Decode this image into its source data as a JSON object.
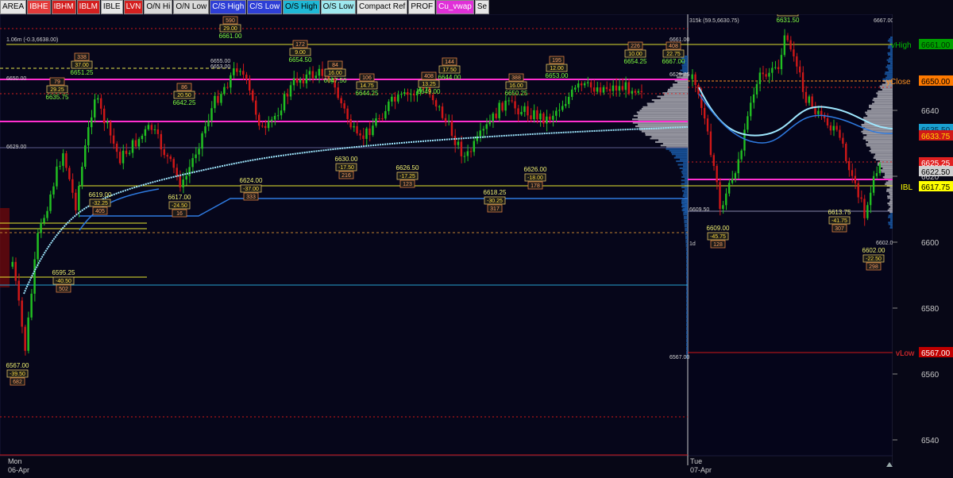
{
  "toolbar": {
    "buttons": [
      {
        "label": "AREA",
        "bg": "#e6e6e6",
        "fg": "#000000"
      },
      {
        "label": "IBHE",
        "bg": "#e33b3b",
        "fg": "#ffffff"
      },
      {
        "label": "IBHM",
        "bg": "#d42020",
        "fg": "#ffffff"
      },
      {
        "label": "IBLM",
        "bg": "#d42020",
        "fg": "#ffffff"
      },
      {
        "label": "IBLE",
        "bg": "#e6e6e6",
        "fg": "#000000"
      },
      {
        "label": "LVN",
        "bg": "#d42020",
        "fg": "#ffffff"
      },
      {
        "label": "O/N Hi",
        "bg": "#d9d9d9",
        "fg": "#000000"
      },
      {
        "label": "O/N Low",
        "bg": "#d9d9d9",
        "fg": "#000000"
      },
      {
        "label": "C/S High",
        "bg": "#2e3fd6",
        "fg": "#ffffff"
      },
      {
        "label": "C/S Low",
        "bg": "#2e3fd6",
        "fg": "#ffffff"
      },
      {
        "label": "O/S High",
        "bg": "#1fb8d6",
        "fg": "#000000"
      },
      {
        "label": "O/S Low",
        "bg": "#9ee8ef",
        "fg": "#000000"
      },
      {
        "label": "Compact Ref",
        "bg": "#e6e6e6",
        "fg": "#000000"
      },
      {
        "label": "PROF",
        "bg": "#e6e6e6",
        "fg": "#000000"
      },
      {
        "label": "Cu_vwap",
        "bg": "#e030d8",
        "fg": "#ffffff"
      },
      {
        "label": "Se",
        "bg": "#e6e6e6",
        "fg": "#000000"
      }
    ]
  },
  "window_controls": [
    "minimize",
    "restore",
    "close"
  ],
  "price_axis": {
    "ticks": [
      "6640",
      "6620",
      "6600",
      "6580",
      "6560",
      "6540"
    ],
    "labels": [
      {
        "name": "vhigh",
        "tag": "vHigh",
        "value": "6661.00",
        "tag_color": "#00c000",
        "value_bg": "#00a000",
        "value_fg": "#003000"
      },
      {
        "name": "yclose",
        "tag": "yClose",
        "value": "6650.00",
        "tag_color": "#ff9020",
        "value_bg": "#ff7a00",
        "value_fg": "#000000"
      },
      {
        "name": "vwap",
        "tag": "",
        "value": "6635.50",
        "tag_color": "#20b0e0",
        "value_bg": "#1aa0d0",
        "value_fg": "#00304a"
      },
      {
        "name": "redlvl",
        "tag": "",
        "value": "6633.75",
        "tag_color": "#e02020",
        "value_bg": "#d01818",
        "value_fg": "#ffdd00"
      },
      {
        "name": "current1",
        "tag": "",
        "value": "6625.25",
        "tag_color": "#ff4040",
        "value_bg": "#e02020",
        "value_fg": "#ffffff"
      },
      {
        "name": "current2",
        "tag": "",
        "value": "6622.50",
        "tag_color": "#999999",
        "value_bg": "#d0d0d0",
        "value_fg": "#000000"
      },
      {
        "name": "ibl",
        "tag": "IBL",
        "value": "6617.75",
        "tag_color": "#ffff00",
        "value_bg": "#ffff00",
        "value_fg": "#000000"
      },
      {
        "name": "vlow",
        "tag": "vLow",
        "value": "6567.00",
        "tag_color": "#ff3030",
        "value_bg": "#c00000",
        "value_fg": "#ffffff"
      }
    ]
  },
  "day_labels": [
    {
      "dow": "Mon",
      "date": "06-Apr"
    },
    {
      "dow": "Tue",
      "date": "07-Apr"
    }
  ],
  "profile1": {
    "volume": "1.06m (-0.3,6638.00)",
    "levels": [
      "6650.00",
      "6629.00",
      "6655.00",
      "6653.00",
      "6567.00"
    ],
    "side_labels": [
      "6661.00",
      "6629.75"
    ]
  },
  "profile2": {
    "volume": "315k (59.5,6630.75)",
    "levels": [
      "6609.50",
      "6620.00",
      "6602.00",
      "6667.00"
    ],
    "side": "1d"
  },
  "swing_labels": [
    {
      "price": "6567.00",
      "delta": "-39.50",
      "vol": "682",
      "color": "#f0f070"
    },
    {
      "price": "6595.25",
      "delta": "-40.50",
      "vol": "502",
      "color": "#f0f070"
    },
    {
      "price": "6619.00",
      "delta": "-32.25",
      "vol": "405",
      "color": "#f0f070"
    },
    {
      "price": "6617.00",
      "delta": "-24.50",
      "vol": "16",
      "color": "#f0f070"
    },
    {
      "price": "6624.00",
      "delta": "-37.00",
      "vol": "333",
      "color": "#f0f070"
    },
    {
      "price": "6630.00",
      "delta": "-17.50",
      "vol": "216",
      "color": "#f0f070"
    },
    {
      "price": "6626.50",
      "delta": "-17.25",
      "vol": "123",
      "color": "#f0f070"
    },
    {
      "price": "6618.25",
      "delta": "-30.25",
      "vol": "317",
      "color": "#f0f070"
    },
    {
      "price": "6626.00",
      "delta": "-18.00",
      "vol": "178",
      "color": "#f0f070"
    },
    {
      "price": "6609.00",
      "delta": "-45.75",
      "vol": "128",
      "color": "#f0f070"
    },
    {
      "price": "6613.75",
      "delta": "-41.75",
      "vol": "307",
      "color": "#f0f070"
    },
    {
      "price": "6602.00",
      "delta": "-22.50",
      "vol": "298",
      "color": "#f0f070"
    },
    {
      "price": "6651.25",
      "delta": "37.00",
      "vol": "338",
      "color": "#80ff40"
    },
    {
      "price": "6635.75",
      "delta": "29.25",
      "vol": "79",
      "color": "#80ff40"
    },
    {
      "price": "6642.25",
      "delta": "20.50",
      "vol": "86",
      "color": "#80ff40"
    },
    {
      "price": "6661.00",
      "delta": "29.00",
      "vol": "590",
      "color": "#80ff40"
    },
    {
      "price": "6654.50",
      "delta": "9.00",
      "vol": "172",
      "color": "#80ff40"
    },
    {
      "price": "6647.50",
      "delta": "16.00",
      "vol": "84",
      "color": "#80ff40"
    },
    {
      "price": "6644.25",
      "delta": "14.75",
      "vol": "106",
      "color": "#80ff40"
    },
    {
      "price": "6649.00",
      "delta": "13.25",
      "vol": "408",
      "color": "#80ff40"
    },
    {
      "price": "6644.00",
      "delta": "17.50",
      "vol": "144",
      "color": "#80ff40"
    },
    {
      "price": "6650.25",
      "delta": "16.00",
      "vol": "388",
      "color": "#80ff40"
    },
    {
      "price": "6653.00",
      "delta": "12.00",
      "vol": "195",
      "color": "#80ff40"
    },
    {
      "price": "6654.25",
      "delta": "10.00",
      "vol": "226",
      "color": "#80ff40"
    },
    {
      "price": "6667.00",
      "delta": "22.75",
      "vol": "408",
      "color": "#80ff40"
    },
    {
      "price": "6631.50",
      "delta": "17.75",
      "vol": "118",
      "color": "#80ff40"
    }
  ]
}
